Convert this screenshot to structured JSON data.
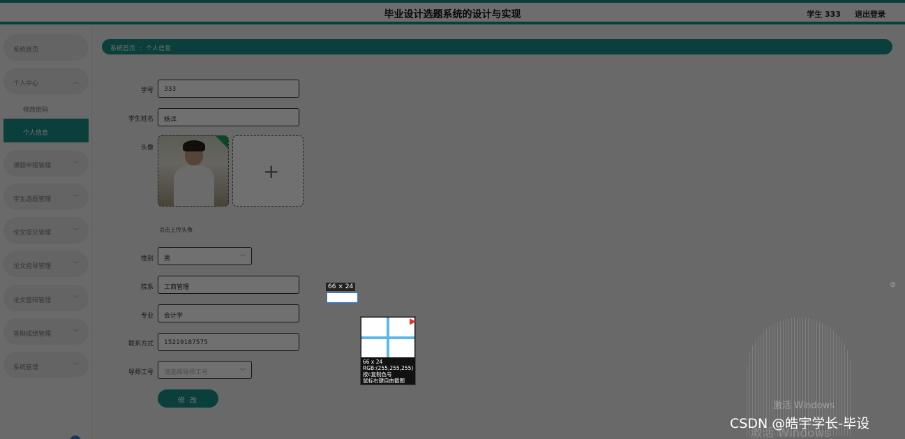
{
  "header": {
    "title": "毕业设计选题系统的设计与实现",
    "user": "学生 333",
    "logout": "退出登录"
  },
  "sidebar": {
    "items": [
      {
        "label": "系统首页"
      },
      {
        "label": "个人中心",
        "expanded": true
      },
      {
        "label": "修改密码"
      },
      {
        "label": "个人信息",
        "active": true
      },
      {
        "label": "课题申报管理"
      },
      {
        "label": "学生选题管理"
      },
      {
        "label": "论文提交管理"
      },
      {
        "label": "论文指导管理"
      },
      {
        "label": "论文答辩管理"
      },
      {
        "label": "答辩成绩管理"
      },
      {
        "label": "系统管理"
      }
    ]
  },
  "breadcrumb": {
    "home": "系统首页",
    "sep": ":",
    "current": "个人信息"
  },
  "form": {
    "student_id_label": "学号",
    "student_id": "333",
    "name_label": "学生姓名",
    "name": "杨洋",
    "avatar_label": "头像",
    "upload_hint": "点击上传头像",
    "gender_label": "性别",
    "gender": "男",
    "college_label": "院系",
    "college": "工商管理",
    "major_label": "专业",
    "major": "会计学",
    "phone_label": "联系方式",
    "phone": "15219187575",
    "advisor_label": "导师工号",
    "advisor_placeholder": "请选择导师工号",
    "submit": "修 改"
  },
  "screenshot_tool": {
    "size_label": "66 × 24",
    "mag_size": "66 x 24",
    "mag_rgb": "RGB:(255,255,255)",
    "mag_copy": "按c复制色号",
    "mag_hint": "鼠标右键自由截图"
  },
  "watermarks": {
    "activate": "激活 Windows",
    "activate_2": "激活 Windows",
    "csdn": "CSDN @皓宇学长-毕设"
  }
}
